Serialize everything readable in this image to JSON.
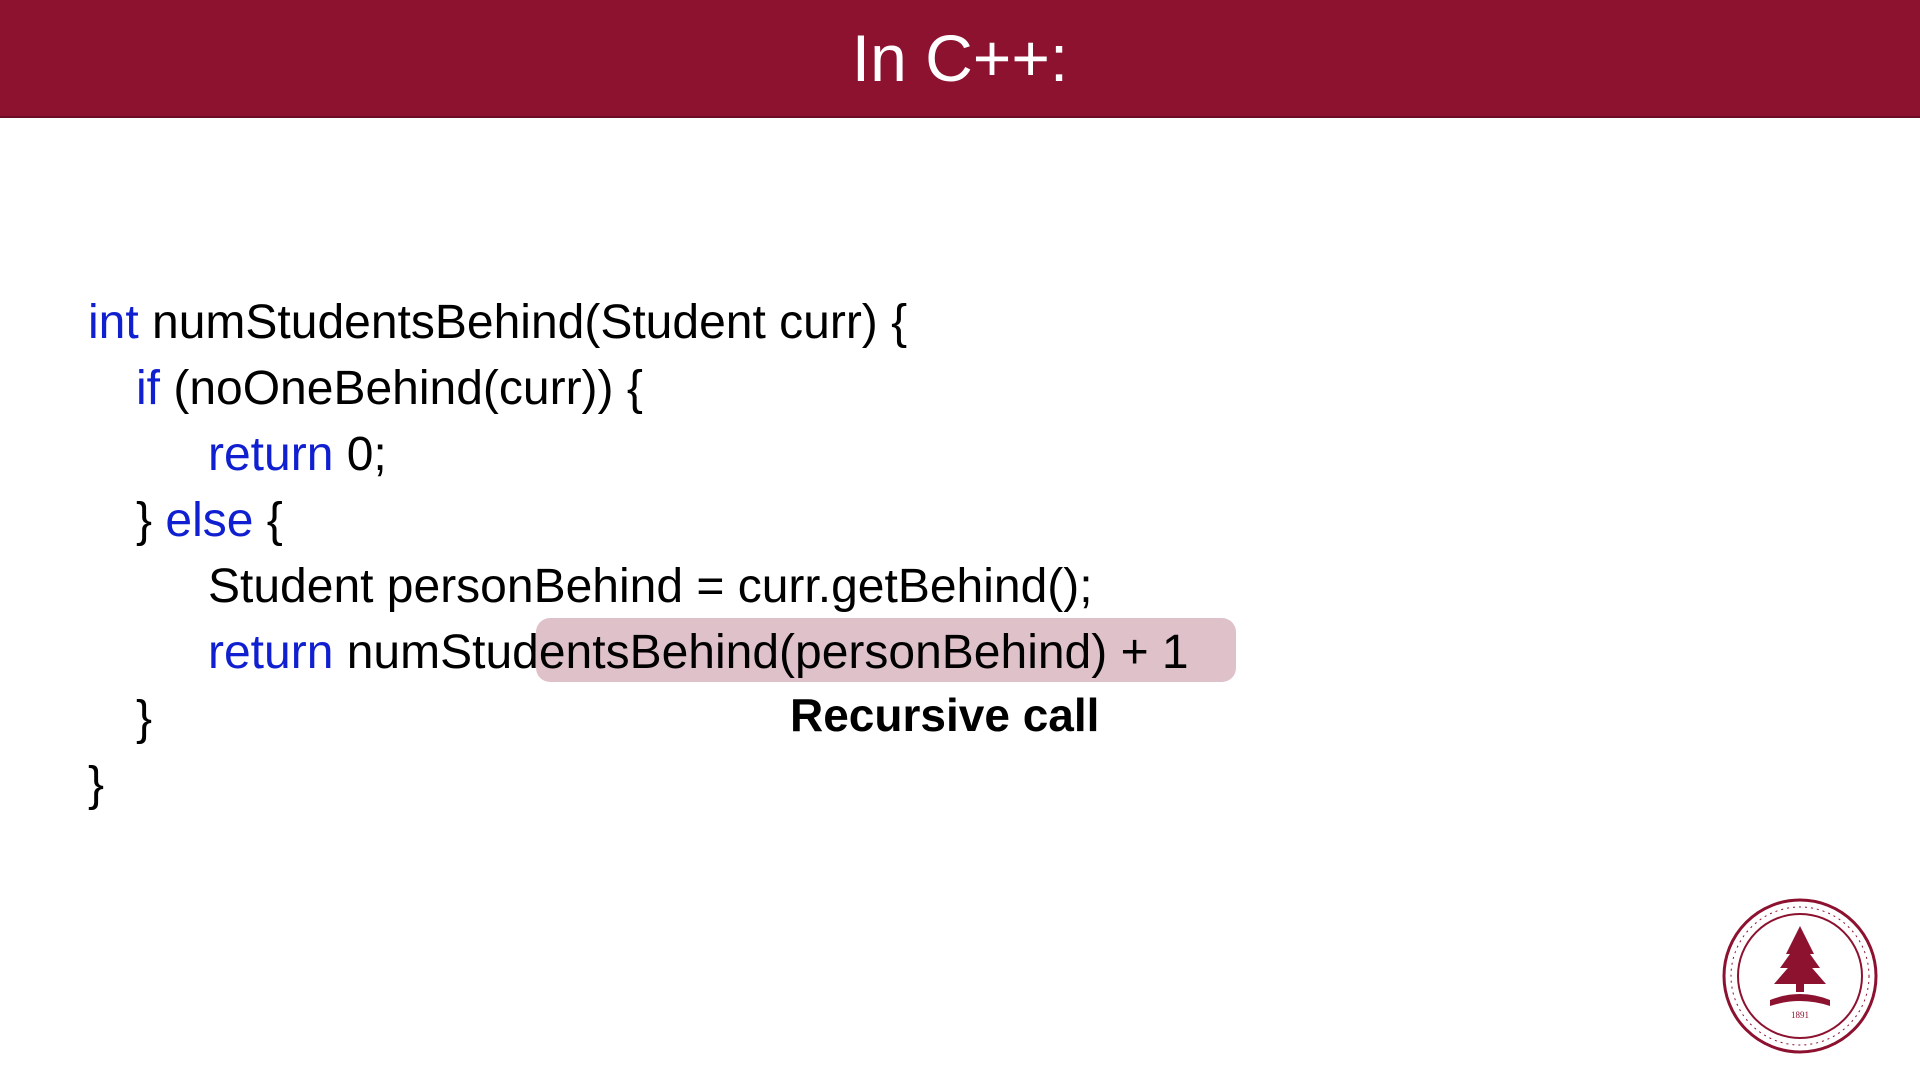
{
  "header": {
    "title": "In C++:"
  },
  "code": {
    "l1_kw": "int",
    "l1_rest": " numStudentsBehind(Student curr) {",
    "l2_kw": "if",
    "l2_rest": " (noOneBehind(curr)) {",
    "l3_kw": "return",
    "l3_rest": " 0;",
    "l4_a": "} ",
    "l4_kw": "else",
    "l4_b": " {",
    "l5": "Student personBehind = curr.getBehind();",
    "l6_kw": "return",
    "l6_rest": " numStudentsBehind(personBehind) + 1",
    "l7": "}",
    "l8": "}"
  },
  "annotation": "Recursive call",
  "colors": {
    "header_bg": "#8c1230",
    "keyword": "#1020d0",
    "highlight": "#d9b6bf"
  },
  "seal": {
    "label": "Stanford University seal"
  }
}
